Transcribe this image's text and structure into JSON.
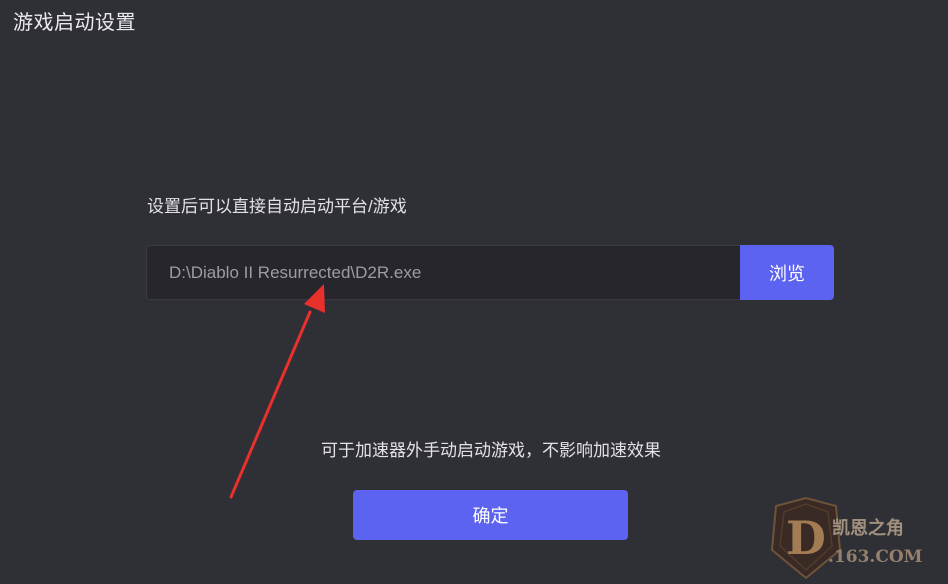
{
  "dialog": {
    "title": "游戏启动设置",
    "hint": "设置后可以直接自动启动平台/游戏",
    "path_value": "D:\\Diablo II Resurrected\\D2R.exe",
    "browse_label": "浏览",
    "note": "可于加速器外手动启动游戏，不影响加速效果",
    "confirm_label": "确定"
  },
  "annotation": {
    "arrow_color": "#e8302c"
  },
  "watermark": {
    "logo_letter": "D",
    "site_name": "凯恩之角",
    "domain": ".163.COM"
  },
  "colors": {
    "background": "#2f2f36",
    "accent": "#5b63f0",
    "input_bg": "#26262c"
  }
}
